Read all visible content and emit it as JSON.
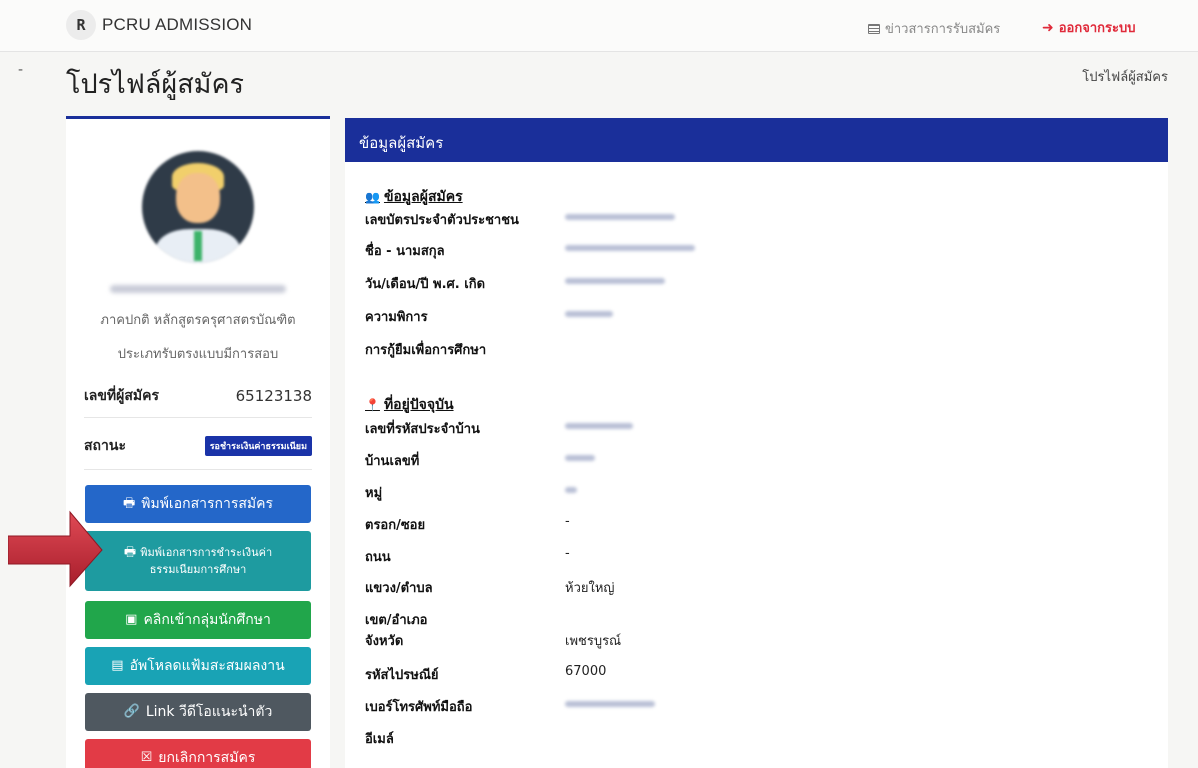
{
  "navbar": {
    "brand_logo": "R",
    "brand": "PCRU ADMISSION",
    "news_label": "ข่าวสารการรับสมัคร",
    "logout_label": "ออกจากระบบ",
    "logout_color": "#e02a3a"
  },
  "page": {
    "title": "โปรไฟล์ผู้สมัคร",
    "breadcrumb": "โปรไฟล์ผู้สมัคร",
    "marker": "-"
  },
  "profile": {
    "program_line1": "ภาคปกติ หลักสูตรครุศาสตรบัณฑิต",
    "program_line2": "ประเภทรับตรงแบบมีการสอบ",
    "applicant_no_label": "เลขที่ผู้สมัคร",
    "applicant_no": "65123138",
    "status_label": "สถานะ",
    "status_badge": "รอชำระเงินค่าธรรมเนียม"
  },
  "buttons": {
    "print_application": "พิมพ์เอกสารการสมัคร",
    "print_fee_line1": "พิมพ์เอกสารการชำระเงินค่า",
    "print_fee_line2": "ธรรมเนียมการศึกษา",
    "join_group": "คลิกเข้ากลุ่มนักศึกษา",
    "upload_portfolio": "อัพโหลดแฟ้มสะสมผลงาน",
    "video_link": "Link วีดีโอแนะนำตัว",
    "cancel_application": "ยกเลิกการสมัคร"
  },
  "info": {
    "header": "ข้อมูลผู้สมัคร",
    "personal_title": "ข้อมูลผู้สมัคร",
    "national_id_label": "เลขบัตรประจำตัวประชาชน",
    "name_label": "ชื่อ - นามสกุล",
    "birthdate_label": "วัน/เดือน/ปี พ.ศ. เกิด",
    "disability_label": "ความพิการ",
    "student_loan_label": "การกู้ยืมเพื่อการศึกษา",
    "address_title": "ที่อยู่ปัจจุบัน",
    "house_code_label": "เลขที่รหัสประจำบ้าน",
    "house_no_label": "บ้านเลขที่",
    "moo_label": "หมู่",
    "soi_label": "ตรอก/ซอย",
    "soi_value": "-",
    "road_label": "ถนน",
    "road_value": "-",
    "subdistrict_label": "แขวง/ตำบล",
    "subdistrict_value": "ห้วยใหญ่",
    "district_label": "เขต/อำเภอ",
    "province_label": "จังหวัด",
    "province_value": "เพชรบูรณ์",
    "postcode_label": "รหัสไปรษณีย์",
    "postcode_value": "67000",
    "mobile_label": "เบอร์โทรศัพท์มือถือ",
    "email_label": "อีเมล์"
  },
  "colors": {
    "primary": "#1a2f9a",
    "btn_blue": "#2467c9",
    "btn_teal": "#1e9ba0",
    "btn_green": "#21a64b",
    "btn_cyan": "#19a3b5",
    "btn_gray": "#4f5860",
    "btn_red": "#e23b46",
    "arrow": "#c8283a"
  },
  "icons": {
    "brand": "brand-logo-icon",
    "news": "newspaper-icon",
    "logout": "sign-out-icon",
    "print": "printer-icon",
    "group": "chat-group-icon",
    "upload": "file-upload-icon",
    "link": "link-icon",
    "cancel": "close-box-icon",
    "users": "users-icon",
    "location": "map-marker-icon"
  }
}
